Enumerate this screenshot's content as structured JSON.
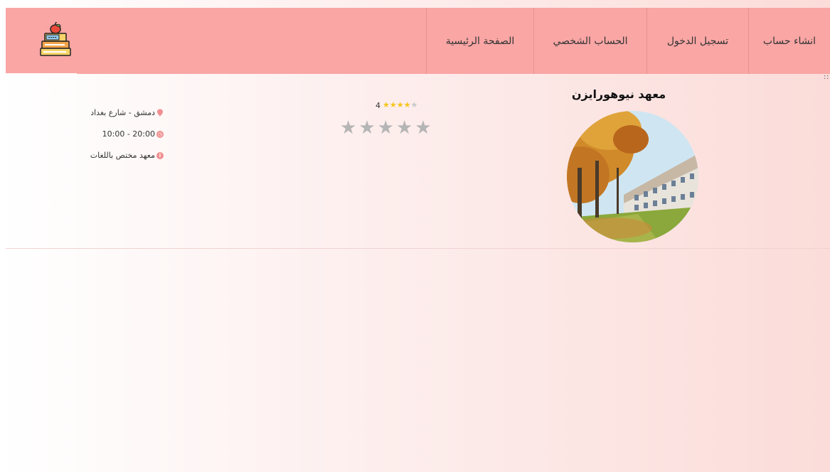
{
  "navbar": {
    "items": [
      {
        "label": "انشاء حساب"
      },
      {
        "label": "تسجيل الدخول"
      },
      {
        "label": "الحساب الشخصي"
      },
      {
        "label": "الصفحة الرئيسية"
      }
    ],
    "background": "#f9a6a5"
  },
  "logo": {
    "icon": "books-apple-icon"
  },
  "institute": {
    "name": "معهد نيوهورايزن",
    "photo": "autumn-building-photo",
    "rating_value": "4",
    "rating_stars_filled": 4,
    "rating_stars_total": 5,
    "user_rating_stars": 5,
    "location": "دمشق - شارع بغداد",
    "hours": "10:00 - 20:00",
    "description": "معهد مختص باللغات"
  },
  "colors": {
    "star_filled": "#f5c518",
    "star_empty": "#b5b5b5",
    "accent": "#f08f8f"
  }
}
